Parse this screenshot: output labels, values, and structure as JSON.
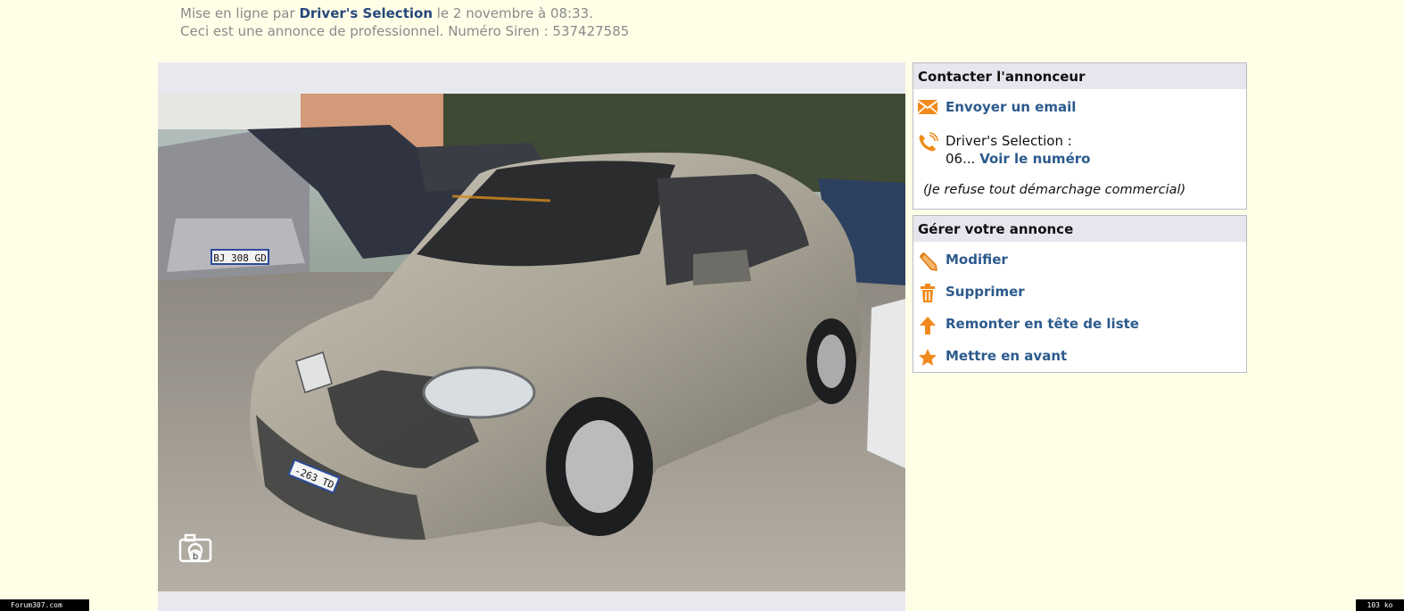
{
  "meta": {
    "posted_prefix": "Mise en ligne par ",
    "author": "Driver's Selection",
    "posted_suffix": " le 2 novembre à 08:33.",
    "pro_notice": "Ceci est une annonce de professionnel. Numéro Siren : 537427585"
  },
  "photo": {
    "alt": "Peugeot 307 grise",
    "plate_left": "BJ 308 GD",
    "plate_car": "-263 TD"
  },
  "contact": {
    "title": "Contacter l'annonceur",
    "email_label": "Envoyer un email",
    "seller_line": "Driver's Selection :",
    "phone_prefix": "06...",
    "phone_link": "Voir le numéro",
    "disclaimer": "(Je refuse tout démarchage commercial)"
  },
  "manage": {
    "title": "Gérer votre annonce",
    "edit": "Modifier",
    "delete": "Supprimer",
    "bump": "Remonter en tête de liste",
    "feature": "Mettre en avant"
  },
  "footer": {
    "site": "Forum307.com",
    "size": "103 ko"
  },
  "colors": {
    "background": "#ffffe8",
    "link": "#2c5a8c",
    "icon_orange": "#f08a1c"
  }
}
